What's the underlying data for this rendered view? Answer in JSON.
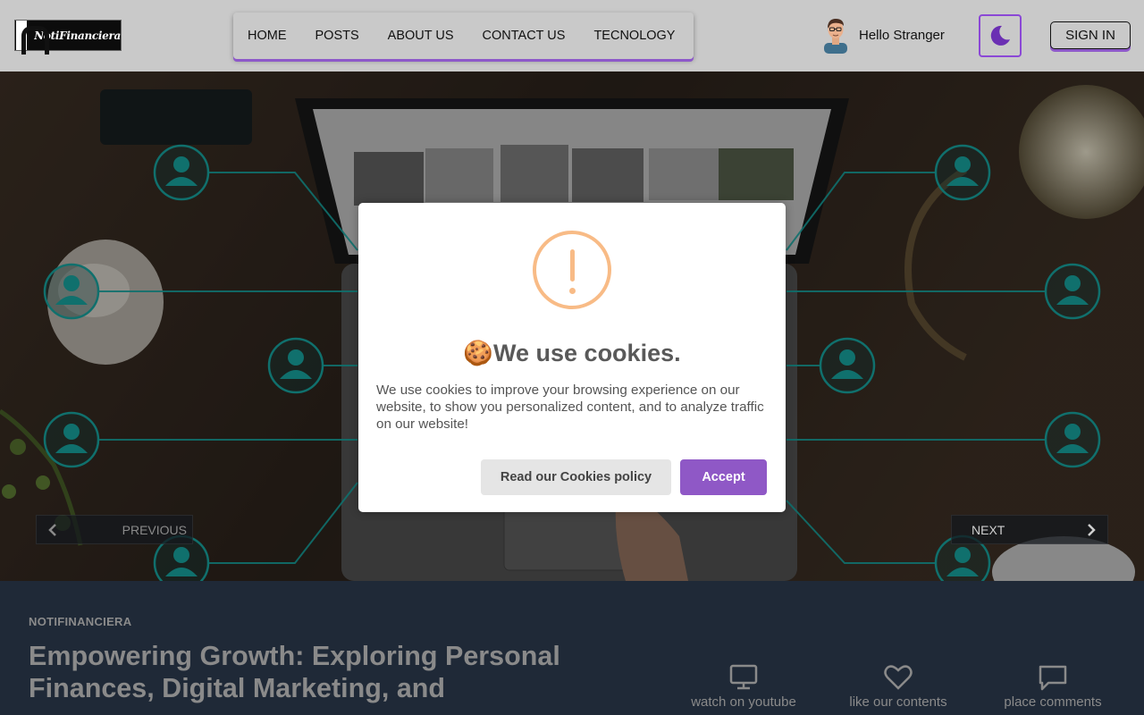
{
  "header": {
    "logo_text": "NotiFinanciera",
    "nav": [
      "HOME",
      "POSTS",
      "ABOUT US",
      "CONTACT US",
      "TECNOLOGY"
    ],
    "greeting": "Hello Stranger",
    "sign_in": "SIGN IN",
    "theme_icon": "moon-icon"
  },
  "carousel": {
    "prev_label": "PREVIOUS",
    "next_label": "NEXT"
  },
  "cookie_modal": {
    "icon": "warning-icon",
    "title": "🍪We use cookies.",
    "body": "We use cookies to improve your browsing experience on our website, to show you personalized content, and to analyze traffic on our website!",
    "policy_button": "Read our Cookies policy",
    "accept_button": "Accept"
  },
  "section": {
    "eyebrow": "NOTIFINANCIERA",
    "headline": "Empowering Growth: Exploring Personal Finances, Digital Marketing, and",
    "features": [
      {
        "icon": "monitor-icon",
        "label": "watch on youtube"
      },
      {
        "icon": "heart-icon",
        "label": "like our contents"
      },
      {
        "icon": "comment-icon",
        "label": "place comments"
      }
    ]
  },
  "colors": {
    "accent": "#8f58c6",
    "header_bg": "#c9c9c9",
    "section_bg": "#1f2937",
    "network_teal": "#1ab5b0"
  }
}
